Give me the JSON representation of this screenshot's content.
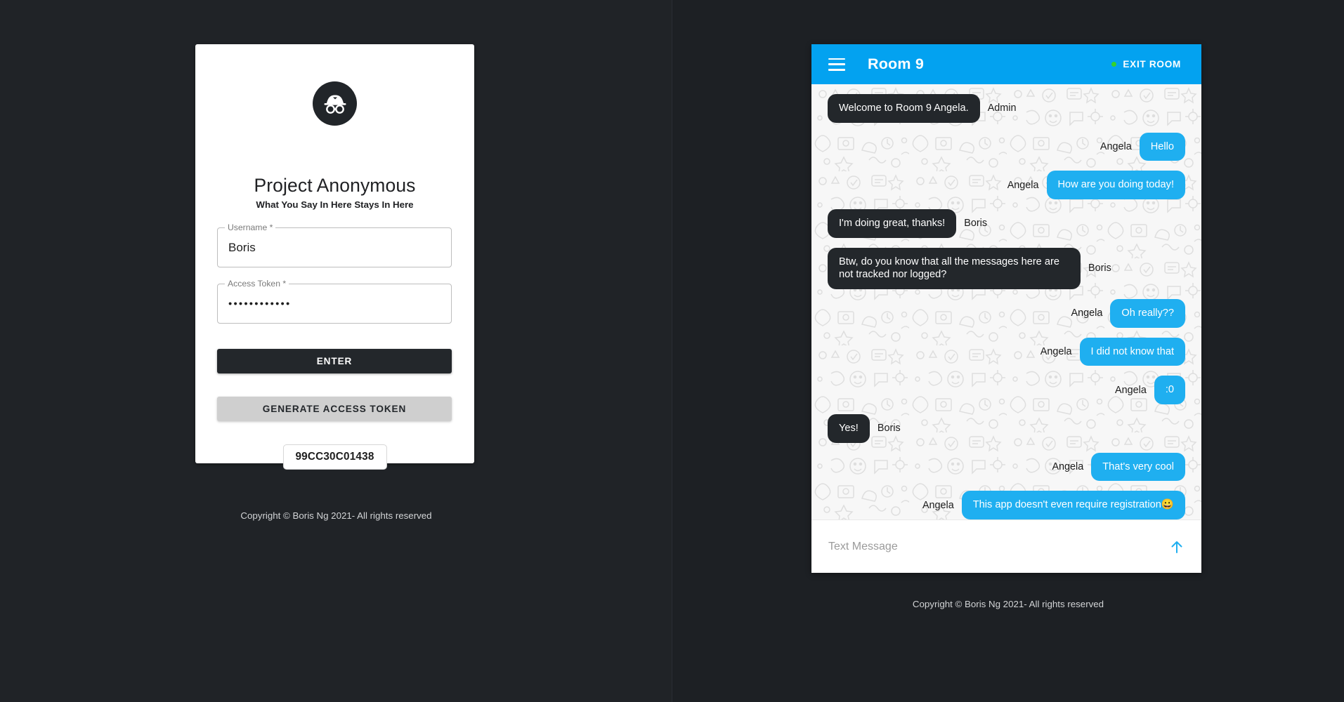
{
  "login": {
    "logo_icon": "incognito-hat-glasses-icon",
    "title": "Project Anonymous",
    "tagline": "What You Say In Here Stays In Here",
    "fields": [
      {
        "label": "Username *",
        "value": "Boris",
        "masked": false
      },
      {
        "label": "Access Token *",
        "value": "••••••••••••",
        "masked": true
      }
    ],
    "enter_label": "ENTER",
    "generate_label": "GENERATE ACCESS TOKEN",
    "generated_token": "99CC30C01438"
  },
  "chat": {
    "menu_icon": "hamburger-menu-icon",
    "room_title": "Room 9",
    "status_dot_color": "#35d22a",
    "exit_label": "EXIT ROOM",
    "header_color": "#03A2F0",
    "bubble_blue": "#1FAFF0",
    "bubble_dark": "#23272b",
    "messages": [
      {
        "sender": "Admin",
        "text": "Welcome to Room 9 Angela.",
        "side": "left",
        "style": "dark"
      },
      {
        "sender": "Angela",
        "text": "Hello",
        "side": "right",
        "style": "blue"
      },
      {
        "sender": "Angela",
        "text": "How are you doing today!",
        "side": "right",
        "style": "blue"
      },
      {
        "sender": "Boris",
        "text": "I'm doing great, thanks!",
        "side": "left",
        "style": "dark"
      },
      {
        "sender": "Boris",
        "text": "Btw, do you know that all the messages here are not tracked nor logged?",
        "side": "left",
        "style": "dark"
      },
      {
        "sender": "Angela",
        "text": "Oh really??",
        "side": "right",
        "style": "blue"
      },
      {
        "sender": "Angela",
        "text": "I did not know that",
        "side": "right",
        "style": "blue"
      },
      {
        "sender": "Angela",
        "text": ":0",
        "side": "right",
        "style": "blue"
      },
      {
        "sender": "Boris",
        "text": "Yes!",
        "side": "left",
        "style": "dark"
      },
      {
        "sender": "Angela",
        "text": "That's very cool",
        "side": "right",
        "style": "blue"
      },
      {
        "sender": "Angela",
        "text": "This app doesn't even require registration😀",
        "side": "right",
        "style": "blue"
      }
    ],
    "input_placeholder": "Text Message",
    "send_icon": "arrow-up-send-icon"
  },
  "footer": {
    "left_text": "Copyright © Boris Ng 2021- All rights reserved",
    "right_text": "Copyright © Boris Ng 2021- All rights reserved"
  }
}
